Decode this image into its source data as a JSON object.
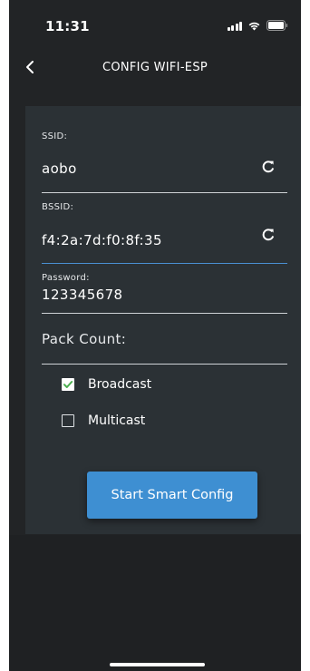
{
  "status_bar": {
    "time": "11:31"
  },
  "nav": {
    "title": "CONFIG WIFI-ESP",
    "back_icon": "chevron-left-icon"
  },
  "form": {
    "ssid": {
      "label": "SSID:",
      "value": "aobo"
    },
    "bssid": {
      "label": "BSSID:",
      "value": "f4:2a:7d:f0:8f:35"
    },
    "password": {
      "label": "Password:",
      "value": "123345678"
    },
    "pack_count": {
      "placeholder": "Pack Count:",
      "value": ""
    },
    "broadcast": {
      "label": "Broadcast",
      "checked": true
    },
    "multicast": {
      "label": "Multicast",
      "checked": false
    },
    "start_button": "Start Smart Config"
  },
  "colors": {
    "background": "#222426",
    "panel": "#2b3135",
    "accent": "#3e8fd2",
    "check_color": "#4caf50"
  }
}
